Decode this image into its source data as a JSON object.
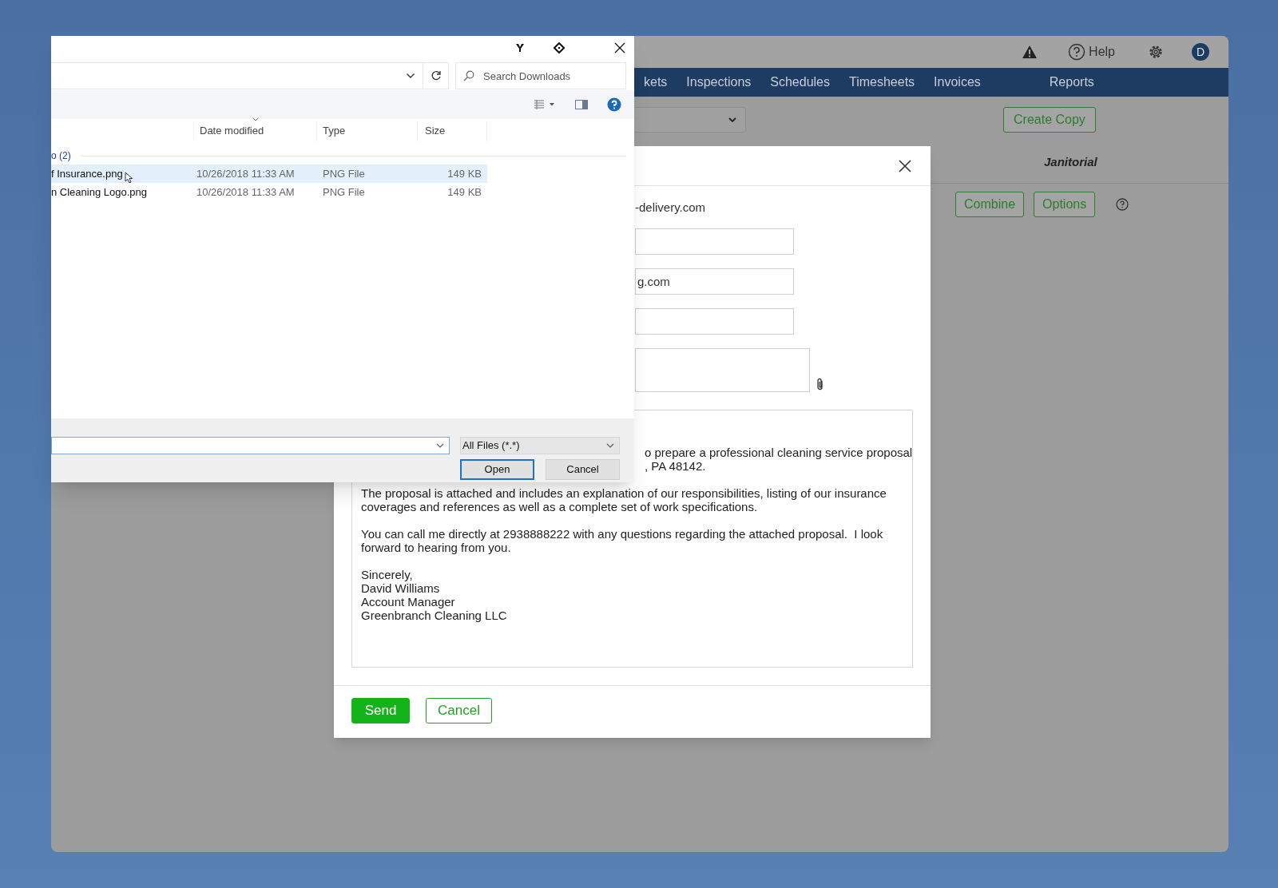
{
  "file_dialog": {
    "search": {
      "placeholder": "Search Downloads"
    },
    "columns": [
      "Date modified",
      "Type",
      "Size"
    ],
    "group": "o (2)",
    "files": [
      {
        "name": "f Insurance.png",
        "date": "10/26/2018 11:33 AM",
        "type": "PNG File",
        "size": "149 KB",
        "selected": true
      },
      {
        "name": "n Cleaning Logo.png",
        "date": "10/26/2018 11:33 AM",
        "type": "PNG File",
        "size": "149 KB",
        "selected": false
      }
    ],
    "file_type": "All Files (*.*)",
    "buttons": [
      {
        "label": "Open",
        "kind": "default"
      },
      {
        "label": "Cancel",
        "kind": "normal"
      }
    ]
  },
  "app": {
    "help": "Help",
    "avatar": "D",
    "nav": [
      "kets",
      "Inspections",
      "Schedules",
      "Timesheets",
      "Invoices",
      "Reports"
    ],
    "create_copy": "Create Copy",
    "panel_title": "Janitorial",
    "actions": [
      "Combine",
      "Options"
    ]
  },
  "email": {
    "recipient": "-delivery.com",
    "fields": [
      {
        "kind": "input"
      },
      {
        "kind": "input",
        "value": "g.com"
      },
      {
        "kind": "input"
      },
      {
        "kind": "attachments"
      }
    ],
    "body": {
      "fragment_lines": [
        "o prepare a professional cleaning service proposal",
        ", PA 48142."
      ],
      "paragraphs": [
        "The proposal is attached and includes an explanation of our responsibilities, listing of our insurance coverages and references as well as a complete set of work specifications.",
        "You can call me directly at 2938888222 with any questions regarding the attached proposal.  I look forward to hearing from you."
      ],
      "signature": [
        "Sincerely,",
        "David Williams",
        "Account Manager",
        "Greenbranch Cleaning LLC"
      ]
    },
    "buttons": [
      {
        "label": "Send",
        "kind": "primary"
      },
      {
        "label": "Cancel",
        "kind": "secondary"
      }
    ]
  }
}
